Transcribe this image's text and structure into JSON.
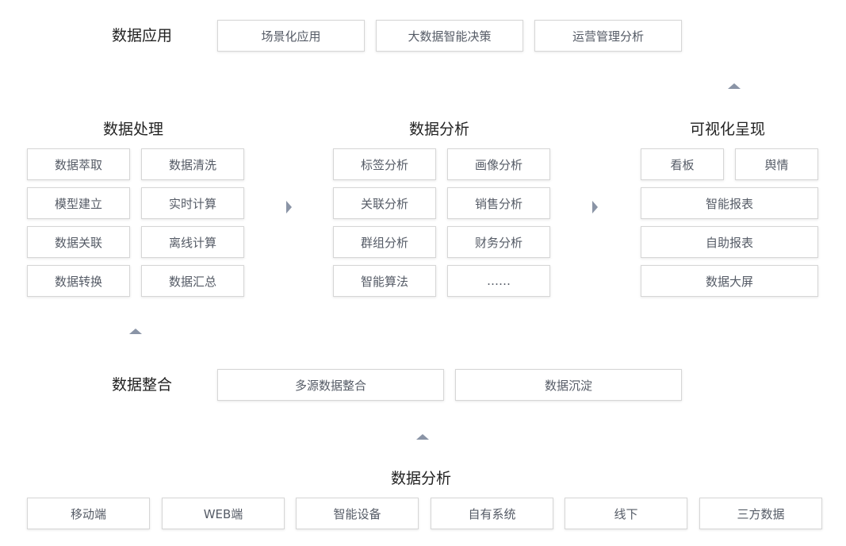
{
  "application": {
    "title": "数据应用",
    "items": [
      "场景化应用",
      "大数据智能决策",
      "运营管理分析"
    ]
  },
  "processing": {
    "title": "数据处理",
    "items": [
      "数据萃取",
      "数据清洗",
      "模型建立",
      "实时计算",
      "数据关联",
      "离线计算",
      "数据转换",
      "数据汇总"
    ]
  },
  "analysis": {
    "title": "数据分析",
    "items": [
      "标签分析",
      "画像分析",
      "关联分析",
      "销售分析",
      "群组分析",
      "财务分析",
      "智能算法",
      "……"
    ]
  },
  "visualization": {
    "title": "可视化呈现",
    "items": [
      "看板",
      "舆情",
      "智能报表",
      "自助报表",
      "数据大屏"
    ]
  },
  "integration": {
    "title": "数据整合",
    "items": [
      "多源数据整合",
      "数据沉淀"
    ]
  },
  "sources": {
    "title": "数据分析",
    "items": [
      "移动端",
      "WEB端",
      "智能设备",
      "自有系统",
      "线下",
      "三方数据"
    ]
  },
  "colors": {
    "arrow": "#8a94a6",
    "box_border": "#d6d6d6",
    "box_text": "#555b66",
    "title_text": "#222222"
  }
}
